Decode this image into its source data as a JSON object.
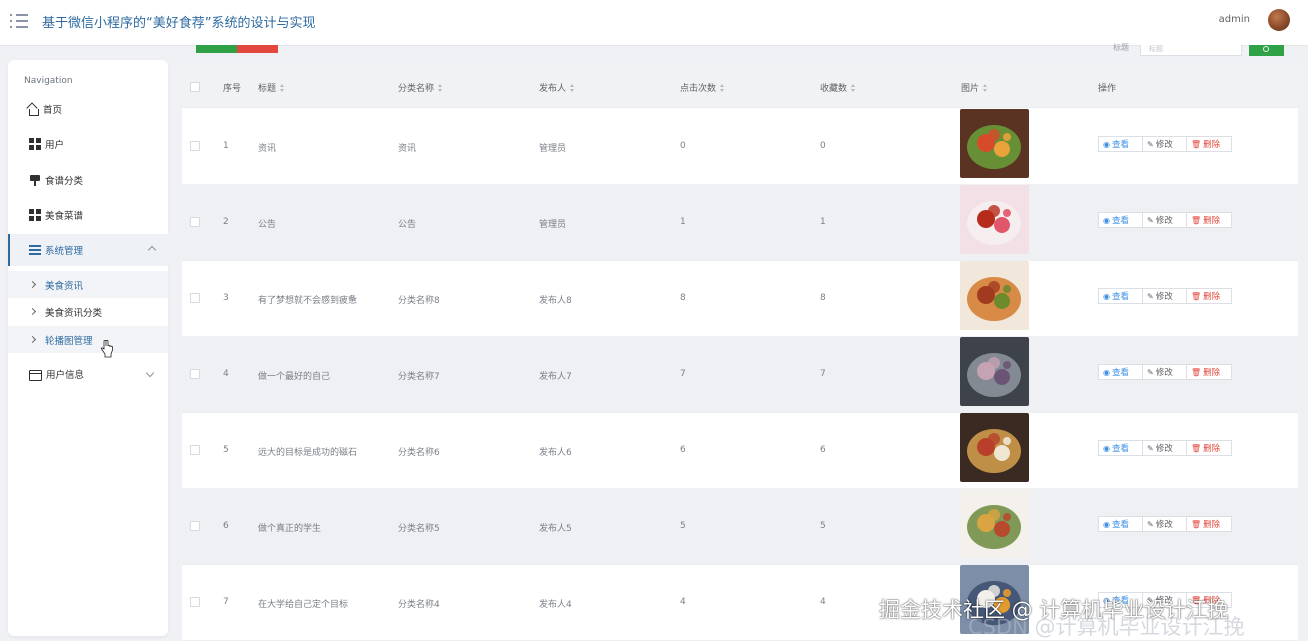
{
  "header": {
    "title": "基于微信小程序的“美好食荐”系统的设计与实现",
    "user": "admin",
    "icons": {
      "menu": "menu-list-icon",
      "avatar": "user-avatar"
    }
  },
  "sidebar": {
    "heading": "Navigation",
    "items": [
      {
        "label": "首页",
        "icon": "home-icon"
      },
      {
        "label": "用户",
        "icon": "grid-icon"
      },
      {
        "label": "食谱分类",
        "icon": "pin-icon"
      },
      {
        "label": "美食菜谱",
        "icon": "grid-icon"
      },
      {
        "label": "系统管理",
        "icon": "list-icon",
        "expanded": true,
        "children": [
          {
            "label": "美食资讯",
            "active": true
          },
          {
            "label": "美食资讯分类"
          },
          {
            "label": "轮播图管理",
            "hovered": true
          }
        ]
      },
      {
        "label": "用户信息",
        "icon": "card-icon"
      }
    ]
  },
  "search": {
    "label": "标题",
    "placeholder": "标题"
  },
  "colors": {
    "accent": "#2e6aa0",
    "green": "#2fa146",
    "red": "#e2483d",
    "link": "#3a8ee6"
  },
  "table": {
    "columns": [
      "序号",
      "标题",
      "分类名称",
      "发布人",
      "点击次数",
      "收藏数",
      "图片",
      "操作"
    ],
    "actions": {
      "view": "查看",
      "edit": "修改",
      "delete": "删除"
    },
    "rows": [
      {
        "no": "1",
        "title": "资讯",
        "category": "资讯",
        "publisher": "管理员",
        "clicks": "0",
        "favorites": "0"
      },
      {
        "no": "2",
        "title": "公告",
        "category": "公告",
        "publisher": "管理员",
        "clicks": "1",
        "favorites": "1"
      },
      {
        "no": "3",
        "title": "有了梦想就不会感到疲惫",
        "category": "分类名称8",
        "publisher": "发布人8",
        "clicks": "8",
        "favorites": "8"
      },
      {
        "no": "4",
        "title": "做一个最好的自己",
        "category": "分类名称7",
        "publisher": "发布人7",
        "clicks": "7",
        "favorites": "7"
      },
      {
        "no": "5",
        "title": "远大的目标是成功的磁石",
        "category": "分类名称6",
        "publisher": "发布人6",
        "clicks": "6",
        "favorites": "6"
      },
      {
        "no": "6",
        "title": "做个真正的学生",
        "category": "分类名称5",
        "publisher": "发布人5",
        "clicks": "5",
        "favorites": "5"
      },
      {
        "no": "7",
        "title": "在大学给自己定个目标",
        "category": "分类名称4",
        "publisher": "发布人4",
        "clicks": "4",
        "favorites": "4"
      }
    ]
  },
  "watermark": {
    "main": "掘金技术社区 @ 计算机毕业设计江挽",
    "shadow": "CSDN @计算机毕业设计江挽"
  }
}
